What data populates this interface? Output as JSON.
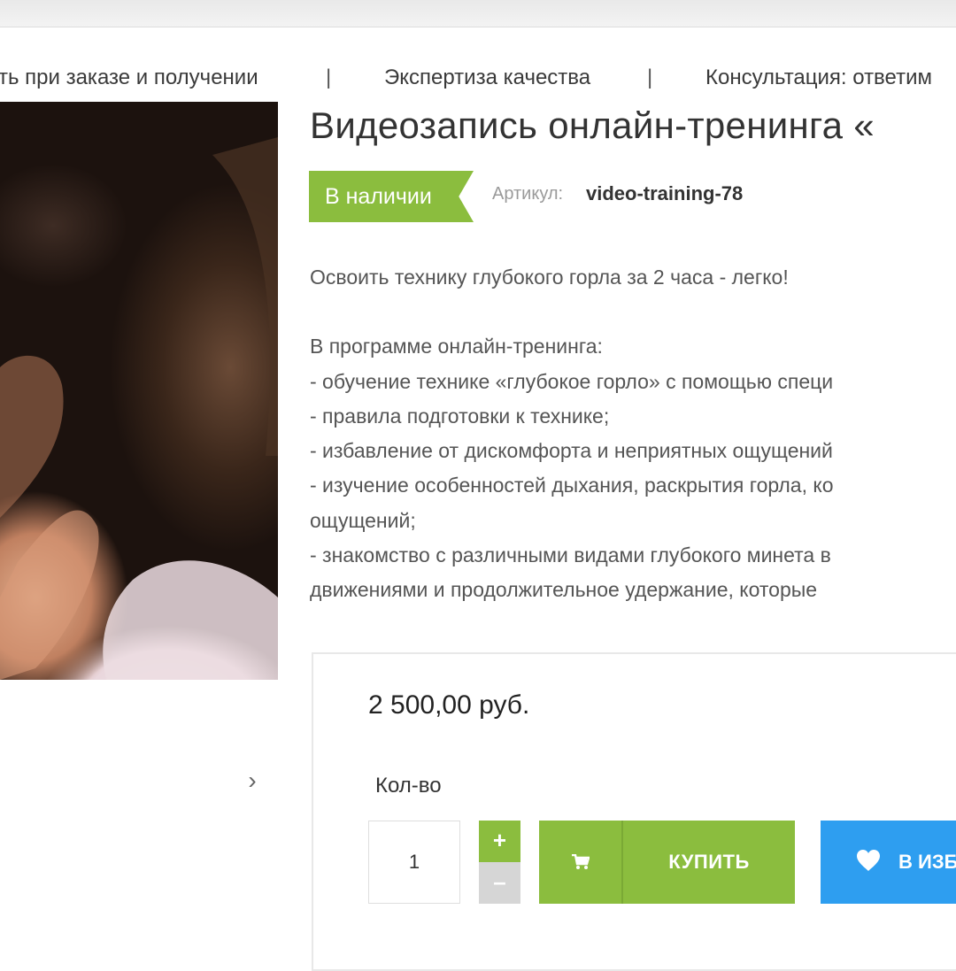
{
  "benefits": [
    {
      "label": "ть при заказе и получении"
    },
    {
      "label": "Экспертиза качества"
    },
    {
      "label": "Консультация: ответим"
    }
  ],
  "benefits_separator": "|",
  "product": {
    "title": "Видеозапись онлайн-тренинга «",
    "stock": "В наличии",
    "sku_label": "Артикул:",
    "sku_value": "video-training-78",
    "description": [
      "Освоить технику глубокого горла за 2 часа - легко!",
      "",
      "В программе онлайн-тренинга:",
      "- обучение технике «глубокое горло» с помощью специ",
      "- правила подготовки к технике;",
      "- избавление от дискомфорта и неприятных ощущений",
      "- изучение особенностей дыхания, раскрытия горла, ко",
      "ощущений;",
      "- знакомство с различными видами глубокого минета в",
      "движениями и продолжительное удержание, которые"
    ]
  },
  "purchase": {
    "price": "2 500,00 руб.",
    "qty_label": "Кол-во",
    "qty_value": "1",
    "plus": "+",
    "minus": "–",
    "buy_label": "КУПИТЬ",
    "fav_label": "В ИЗБ"
  },
  "gallery": {
    "next_arrow": "›",
    "icon_names": [
      "chevron-right-icon",
      "cart-icon",
      "heart-icon"
    ]
  },
  "colors": {
    "accent_green": "#8bbd3e",
    "accent_blue": "#2e9ef0"
  }
}
